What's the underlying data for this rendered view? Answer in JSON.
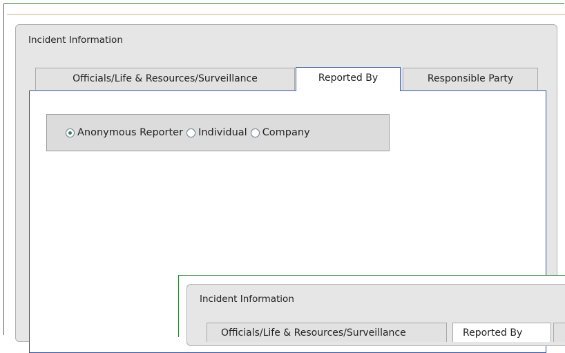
{
  "panel": {
    "title": "Incident Information"
  },
  "tabs": [
    {
      "label": "Officials/Life & Resources/Surveillance",
      "active": false
    },
    {
      "label": "Reported By",
      "active": true
    },
    {
      "label": "Responsible Party",
      "active": false
    }
  ],
  "reporter_type": {
    "selected": "Anonymous Reporter",
    "options": [
      {
        "label": "Anonymous Reporter",
        "checked": true
      },
      {
        "label": "Individual",
        "checked": false
      },
      {
        "label": "Company",
        "checked": false
      }
    ]
  },
  "nested_panel": {
    "title": "Incident Information",
    "tabs": [
      {
        "label": "Officials/Life & Resources/Surveillance"
      },
      {
        "label": "Reported By"
      },
      {
        "label": ""
      }
    ]
  },
  "colors": {
    "frame_border": "#2e7d32",
    "tab_body_border": "#2f4f99",
    "panel_bg": "#e6e6e6",
    "radio_checked": "#2e8b57"
  }
}
